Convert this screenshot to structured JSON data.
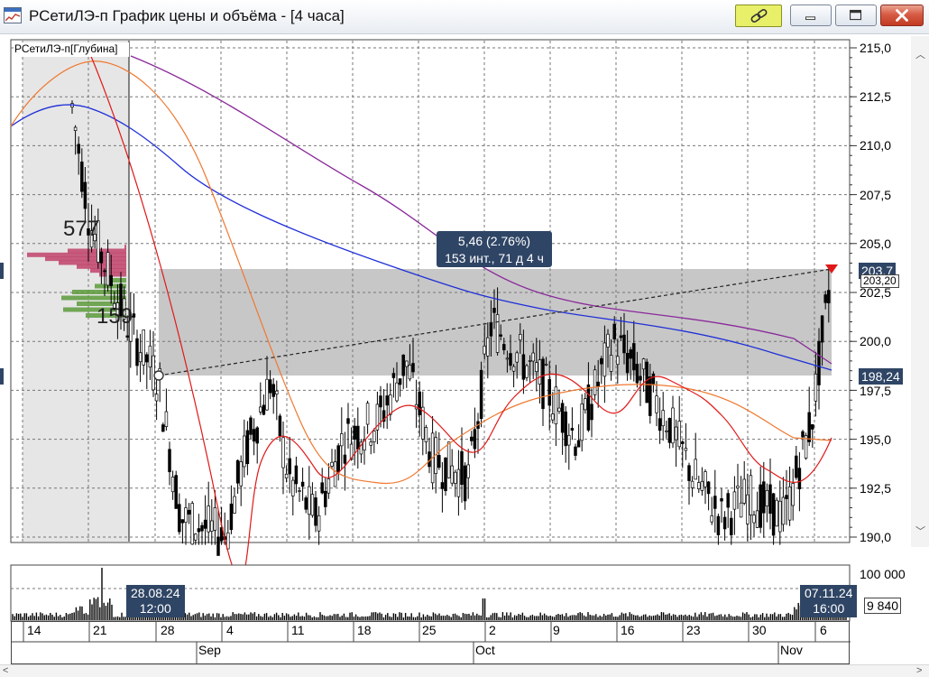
{
  "window": {
    "title": "РСетиЛЭ-п График цены и объёма - [4 часа]",
    "icon": "chart-window-icon",
    "buttons": [
      "link-icon",
      "minimize",
      "maximize",
      "close"
    ]
  },
  "chart": {
    "legend_label": "РСетиЛЭ-п[Глубина]",
    "volume_profile": {
      "upper_label": "577",
      "lower_label": "159"
    },
    "y_ticks": [
      "215,0",
      "212,5",
      "210,0",
      "207,5",
      "205,0",
      "202,5",
      "200,0",
      "197,5",
      "195,0",
      "192,5",
      "190,0"
    ],
    "tooltip": {
      "line1": "5,46 (2.76%)",
      "line2": "153 инт., 71 д 4 ч"
    },
    "price_badges": {
      "upper": "203,7",
      "upper_alt": "203,20",
      "lower": "198,24"
    },
    "colors": {
      "sma_blue": "#1f2fd8",
      "sma_purple": "#8a2a9a",
      "ema_red": "#e01818",
      "ema_orange": "#f07830",
      "badge": "#2f4565"
    }
  },
  "volume": {
    "y_tick_top": "100 000",
    "y_tick_bottom": "9 840",
    "start_label": {
      "line1": "28.08.24",
      "line2": "12:00"
    },
    "end_label": {
      "line1": "07.11.24",
      "line2": "16:00"
    }
  },
  "time_axis": {
    "days": [
      "14",
      "21",
      "28",
      "4",
      "11",
      "18",
      "25",
      "2",
      "9",
      "16",
      "23",
      "30",
      "6"
    ],
    "months": [
      "Sep",
      "Oct",
      "Nov"
    ]
  },
  "chart_data": {
    "type": "candlestick",
    "title": "РСетиЛЭ-п График цены и объёма - [4 часа]",
    "ylim": [
      190.0,
      215.0
    ],
    "y_ticks": [
      215.0,
      212.5,
      210.0,
      207.5,
      205.0,
      202.5,
      200.0,
      197.5,
      195.0,
      192.5,
      190.0
    ],
    "x_ticks": [
      "14",
      "21",
      "28",
      "4",
      "11",
      "18",
      "25",
      "2",
      "9",
      "16",
      "23",
      "30",
      "6"
    ],
    "months": [
      "Sep",
      "Oct",
      "Nov"
    ],
    "measurement": {
      "start": {
        "date": "28.08.24 12:00",
        "price": 198.24
      },
      "end": {
        "date": "07.11.24 16:00",
        "price": 203.7
      },
      "change": "5,46 (2.76%)",
      "span": "153 инт., 71 д 4 ч"
    },
    "close_path": [
      {
        "t": "14",
        "v": 206
      },
      {
        "t": "21",
        "v": 204
      },
      {
        "t": "28",
        "v": 197
      },
      {
        "t": "4",
        "v": 191
      },
      {
        "t": "11",
        "v": 194
      },
      {
        "t": "18",
        "v": 196
      },
      {
        "t": "25",
        "v": 194
      },
      {
        "t": "2",
        "v": 199
      },
      {
        "t": "9",
        "v": 197
      },
      {
        "t": "16",
        "v": 199
      },
      {
        "t": "23",
        "v": 194
      },
      {
        "t": "30",
        "v": 192
      },
      {
        "t": "6",
        "v": 198
      },
      {
        "t": "07.11",
        "v": 203.7
      }
    ],
    "volume_ylim": [
      9840,
      100000
    ]
  }
}
